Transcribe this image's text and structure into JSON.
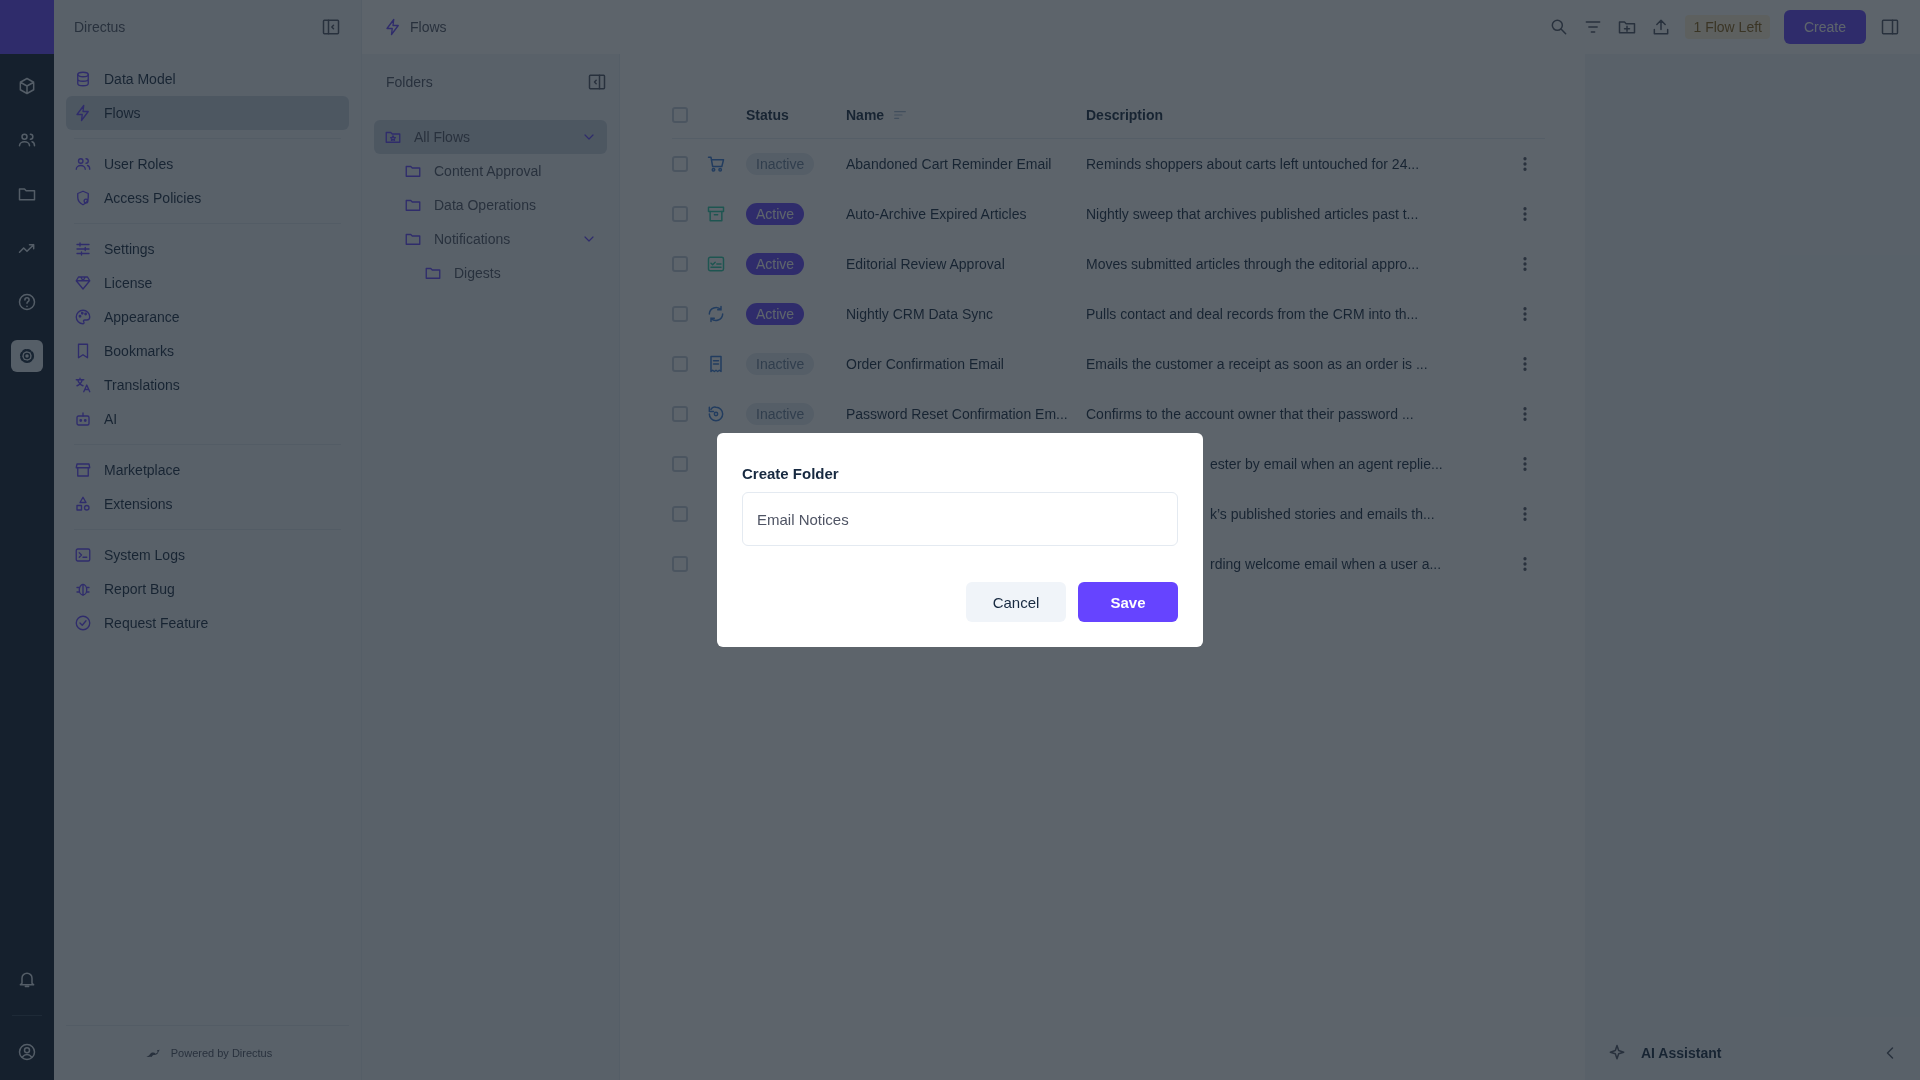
{
  "rail": {
    "items": [
      {
        "kind": "cube",
        "selected": false
      },
      {
        "kind": "users",
        "selected": false
      },
      {
        "kind": "folder",
        "selected": false
      },
      {
        "kind": "chart",
        "selected": false
      },
      {
        "kind": "help",
        "selected": false
      },
      {
        "kind": "settings",
        "selected": true
      }
    ],
    "bottom": [
      {
        "kind": "bell"
      },
      {
        "kind": "account"
      }
    ]
  },
  "nav": {
    "title": "Directus",
    "groups": [
      {
        "items": [
          {
            "kind": "database",
            "label": "Data Model",
            "selected": false
          },
          {
            "kind": "bolt",
            "label": "Flows",
            "selected": true
          }
        ]
      },
      {
        "items": [
          {
            "kind": "users",
            "label": "User Roles",
            "selected": false
          },
          {
            "kind": "shield",
            "label": "Access Policies",
            "selected": false
          }
        ]
      },
      {
        "items": [
          {
            "kind": "sliders",
            "label": "Settings",
            "selected": false
          },
          {
            "kind": "diamond",
            "label": "License",
            "selected": false
          },
          {
            "kind": "palette",
            "label": "Appearance",
            "selected": false
          },
          {
            "kind": "bookmark",
            "label": "Bookmarks",
            "selected": false
          },
          {
            "kind": "translate",
            "label": "Translations",
            "selected": false
          },
          {
            "kind": "robot",
            "label": "AI",
            "selected": false
          }
        ]
      },
      {
        "items": [
          {
            "kind": "store",
            "label": "Marketplace",
            "selected": false
          },
          {
            "kind": "shapes",
            "label": "Extensions",
            "selected": false
          }
        ]
      },
      {
        "items": [
          {
            "kind": "terminal",
            "label": "System Logs",
            "selected": false
          },
          {
            "kind": "bug",
            "label": "Report Bug",
            "selected": false
          },
          {
            "kind": "badge",
            "label": "Request Feature",
            "selected": false
          }
        ]
      }
    ],
    "footer": "Powered by Directus"
  },
  "header": {
    "breadcrumb": "Flows",
    "badge": "1 Flow Left",
    "create_button": "Create"
  },
  "folders": {
    "title": "Folders",
    "tree": [
      {
        "label": "All Flows",
        "kind": "all",
        "selected": true,
        "expanded": true,
        "children": [
          {
            "label": "Content Approval",
            "kind": "folder",
            "selected": false
          },
          {
            "label": "Data Operations",
            "kind": "folder",
            "selected": false
          },
          {
            "label": "Notifications",
            "kind": "folder",
            "selected": false,
            "expanded": true,
            "children": [
              {
                "label": "Digests",
                "kind": "folder",
                "selected": false
              }
            ]
          }
        ]
      }
    ]
  },
  "table": {
    "all_selected": false,
    "columns": [
      {
        "label": "Status",
        "sorted": false
      },
      {
        "label": "Name",
        "sorted": true
      },
      {
        "label": "Description",
        "sorted": false
      }
    ],
    "rows": [
      {
        "kind": "cart",
        "status": "Inactive",
        "active": false,
        "name": "Abandoned Cart Reminder Email",
        "description": "Reminds shoppers about carts left untouched for 24...",
        "selected": false
      },
      {
        "kind": "archive",
        "status": "Active",
        "active": true,
        "name": "Auto-Archive Expired Articles",
        "description": "Nightly sweep that archives published articles past t...",
        "selected": false
      },
      {
        "kind": "checklist",
        "status": "Active",
        "active": true,
        "name": "Editorial Review Approval",
        "description": "Moves submitted articles through the editorial appro...",
        "selected": false
      },
      {
        "kind": "sync",
        "status": "Active",
        "active": true,
        "name": "Nightly CRM Data Sync",
        "description": "Pulls contact and deal records from the CRM into th...",
        "selected": false
      },
      {
        "kind": "receipt",
        "status": "Inactive",
        "active": false,
        "name": "Order Confirmation Email",
        "description": "Emails the customer a receipt as soon as an order is ...",
        "selected": false
      },
      {
        "kind": "history",
        "status": "Inactive",
        "active": false,
        "name": "Password Reset Confirmation Em...",
        "description": "Confirms to the account owner that their password ...",
        "selected": false
      },
      {
        "kind": "covered",
        "description": "ester by email when an agent replie...",
        "selected": false
      },
      {
        "kind": "covered",
        "description": "k’s published stories and emails th...",
        "selected": false
      },
      {
        "kind": "covered",
        "description": "rding welcome email when a user a...",
        "selected": false
      }
    ]
  },
  "ai_assistant": {
    "label": "AI Assistant"
  },
  "dialog": {
    "title": "Create Folder",
    "input": {
      "value": "Email Notices"
    },
    "buttons": [
      {
        "label": "Cancel",
        "kind": "secondary"
      },
      {
        "label": "Save",
        "kind": "primary"
      }
    ]
  }
}
